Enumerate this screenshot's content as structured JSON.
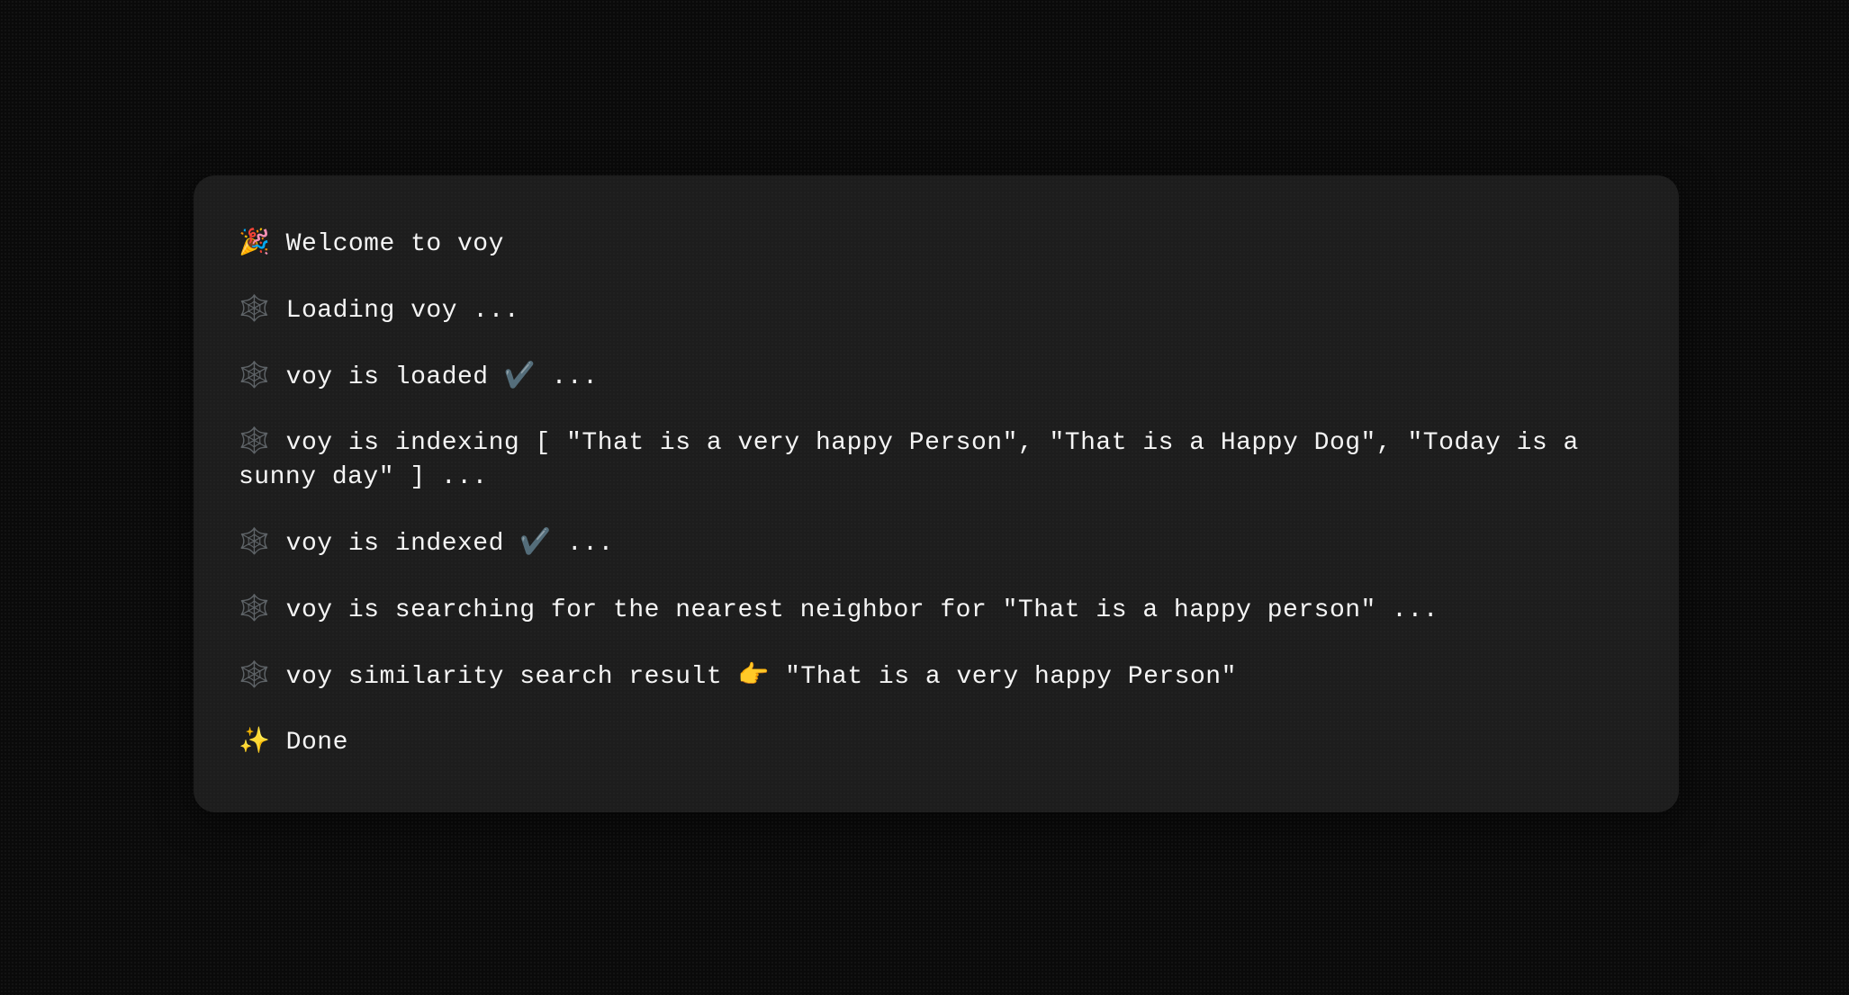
{
  "terminal": {
    "logs": [
      "🎉 Welcome to voy",
      "🕸️ Loading voy ...",
      "🕸️ voy is loaded ✔️ ...",
      "🕸️ voy is indexing [ \"That is a very happy Person\", \"That is a Happy Dog\", \"Today is a sunny day\" ] ...",
      "🕸️ voy is indexed ✔️ ...",
      "🕸️ voy is searching for the nearest neighbor for \"That is a happy person\" ...",
      "🕸️ voy similarity search result 👉 \"That is a very happy Person\"",
      "✨ Done"
    ]
  }
}
